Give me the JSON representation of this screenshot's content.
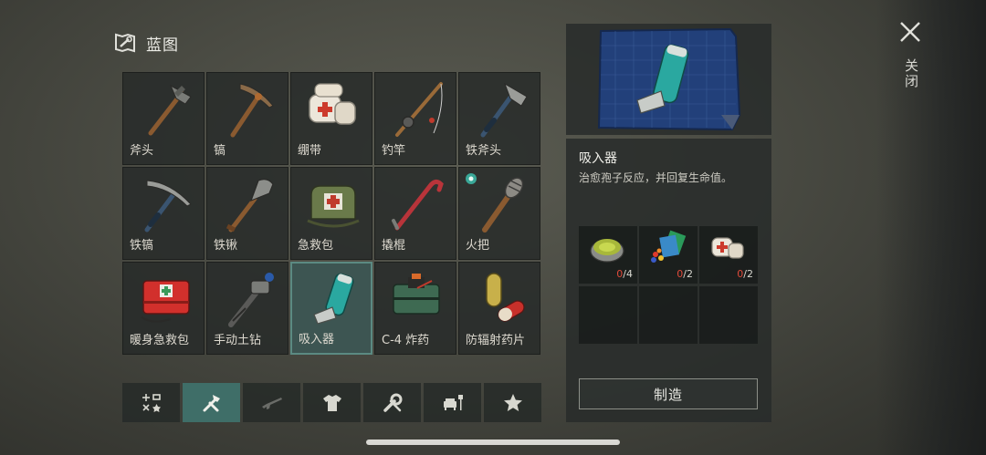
{
  "header": {
    "title": "蓝图",
    "icon": "blueprint-icon"
  },
  "grid": {
    "items": [
      {
        "label": "斧头",
        "icon": "axe-icon"
      },
      {
        "label": "镐",
        "icon": "pickaxe-icon"
      },
      {
        "label": "绷带",
        "icon": "bandage-icon"
      },
      {
        "label": "钓竿",
        "icon": "fishing-rod-icon"
      },
      {
        "label": "铁斧头",
        "icon": "iron-axe-icon"
      },
      {
        "label": "铁镐",
        "icon": "iron-pickaxe-icon"
      },
      {
        "label": "铁锹",
        "icon": "shovel-icon"
      },
      {
        "label": "急救包",
        "icon": "first-aid-bag-icon"
      },
      {
        "label": "撬棍",
        "icon": "crowbar-icon"
      },
      {
        "label": "火把",
        "icon": "torch-icon"
      },
      {
        "label": "暖身急救包",
        "icon": "warming-first-aid-kit-icon"
      },
      {
        "label": "手动土钻",
        "icon": "hand-auger-icon"
      },
      {
        "label": "吸入器",
        "icon": "inhaler-icon"
      },
      {
        "label": "C-4 炸药",
        "icon": "c4-explosive-icon"
      },
      {
        "label": "防辐射药片",
        "icon": "anti-radiation-pills-icon"
      }
    ],
    "selected_index": 12
  },
  "tabs": [
    {
      "name": "all",
      "icon": "all-categories-icon"
    },
    {
      "name": "tools",
      "icon": "tools-icon"
    },
    {
      "name": "weapons",
      "icon": "rifle-icon"
    },
    {
      "name": "clothing",
      "icon": "shirt-icon"
    },
    {
      "name": "parts",
      "icon": "wrench-icon"
    },
    {
      "name": "furniture",
      "icon": "furniture-icon"
    },
    {
      "name": "favorites",
      "icon": "star-icon"
    }
  ],
  "active_tab": 1,
  "detail": {
    "name": "吸入器",
    "description": "治愈孢子反应，并回复生命值。",
    "materials": [
      {
        "icon": "salve-tin-icon",
        "have": "0",
        "need": "/4"
      },
      {
        "icon": "chemicals-icon",
        "have": "0",
        "need": "/2"
      },
      {
        "icon": "bandage-icon",
        "have": "0",
        "need": "/2"
      }
    ],
    "craft_label": "制造"
  },
  "close": {
    "label": "关闭"
  },
  "colors": {
    "selected_border": "#5b8a82",
    "active_tab": "#3f6e68",
    "missing_count": "#e04a3a"
  }
}
